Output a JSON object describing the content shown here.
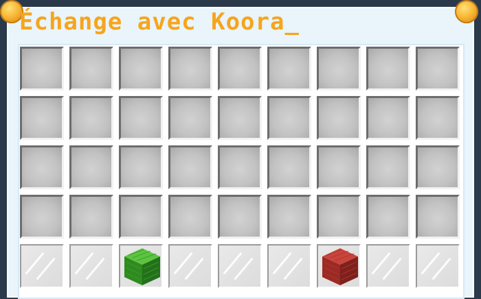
{
  "window": {
    "title": "Échange avec Koora_"
  },
  "colors": {
    "title": "#f6a51c",
    "frame": "#e9f4fb",
    "slot": "#c2c2c2"
  },
  "inventory": {
    "rows": 4,
    "columns": 9
  },
  "hotbar": {
    "items": [
      {
        "type": "glass-pane"
      },
      {
        "type": "glass-pane"
      },
      {
        "type": "green-wool",
        "color": "#3a9a2a"
      },
      {
        "type": "glass-pane"
      },
      {
        "type": "glass-pane"
      },
      {
        "type": "glass-pane"
      },
      {
        "type": "red-wool",
        "color": "#b52f2a"
      },
      {
        "type": "glass-pane"
      },
      {
        "type": "glass-pane"
      }
    ]
  }
}
